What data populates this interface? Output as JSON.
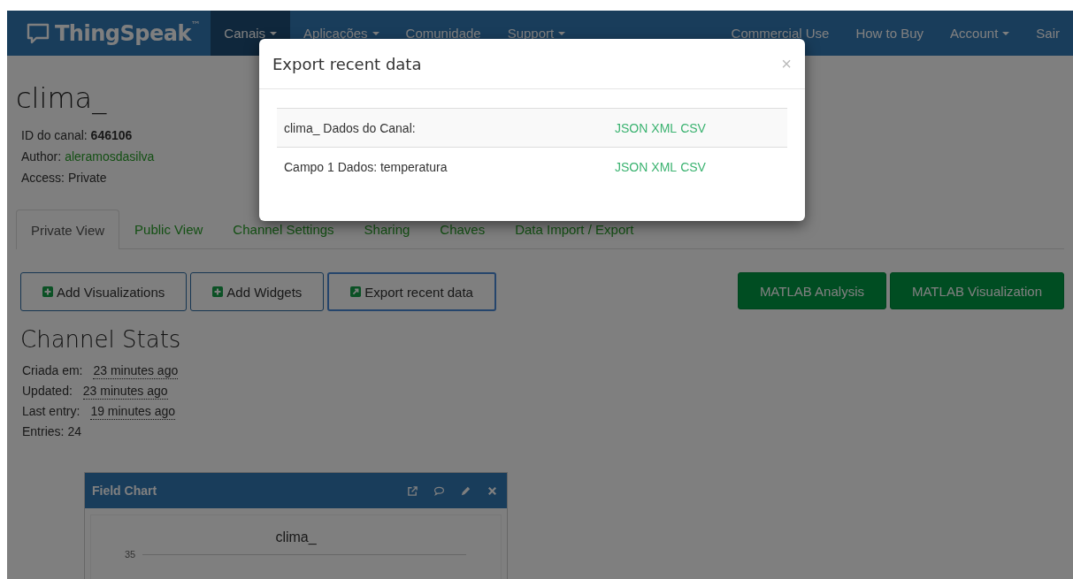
{
  "navbar": {
    "brand": "ThingSpeak",
    "brand_mark": "™",
    "items": [
      {
        "label": "Canais",
        "selected": true,
        "dropdown": true
      },
      {
        "label": "Aplicações",
        "selected": false,
        "dropdown": true
      },
      {
        "label": "Comunidade",
        "selected": false,
        "dropdown": false
      },
      {
        "label": "Support",
        "selected": false,
        "dropdown": true
      }
    ],
    "right_items": [
      {
        "label": "Commercial Use",
        "dropdown": false
      },
      {
        "label": "How to Buy",
        "dropdown": false
      },
      {
        "label": "Account",
        "dropdown": true
      },
      {
        "label": "Sair",
        "dropdown": false
      }
    ]
  },
  "channel": {
    "title": "clima_",
    "id_line": "ID do canal: **646106**",
    "author_label": "Author:",
    "author": "aleramosdasilva",
    "access": "Access: Private"
  },
  "tabs": [
    {
      "label": "Private View",
      "selected": true
    },
    {
      "label": "Public View",
      "selected": false
    },
    {
      "label": "Channel Settings",
      "selected": false
    },
    {
      "label": "Sharing",
      "selected": false
    },
    {
      "label": "Chaves",
      "selected": false
    },
    {
      "label": "Data Import / Export",
      "selected": false
    }
  ],
  "actions": [
    {
      "label": "Add Visualizations",
      "kind": "add",
      "focused": false
    },
    {
      "label": "Add Widgets",
      "kind": "add",
      "focused": false
    },
    {
      "label": "Export recent data",
      "kind": "export",
      "focused": true
    }
  ],
  "matlab_buttons": [
    "MATLAB Analysis",
    "MATLAB Visualization"
  ],
  "stats": {
    "title": "Channel Stats",
    "rows": [
      {
        "label": "Criada em:",
        "value": "23 minutes ago",
        "kind": "time"
      },
      {
        "label": "Updated:",
        "value": "23 minutes ago",
        "kind": "time"
      },
      {
        "label": "Last entry:",
        "value": "19 minutes ago",
        "kind": "time"
      },
      {
        "label": "Entries:",
        "value": "24",
        "kind": "count"
      }
    ]
  },
  "field_chart": {
    "title": "Field Chart",
    "chart_title": "clima_",
    "tick": "35"
  },
  "modal": {
    "title": "Export recent data",
    "close": "×",
    "rows": [
      {
        "label": "clima_ Dados do Canal:",
        "links": [
          "JSON",
          "XML",
          "CSV"
        ]
      },
      {
        "label": "Campo 1 Dados: temperatura",
        "links": [
          "JSON",
          "XML",
          "CSV"
        ]
      }
    ]
  }
}
